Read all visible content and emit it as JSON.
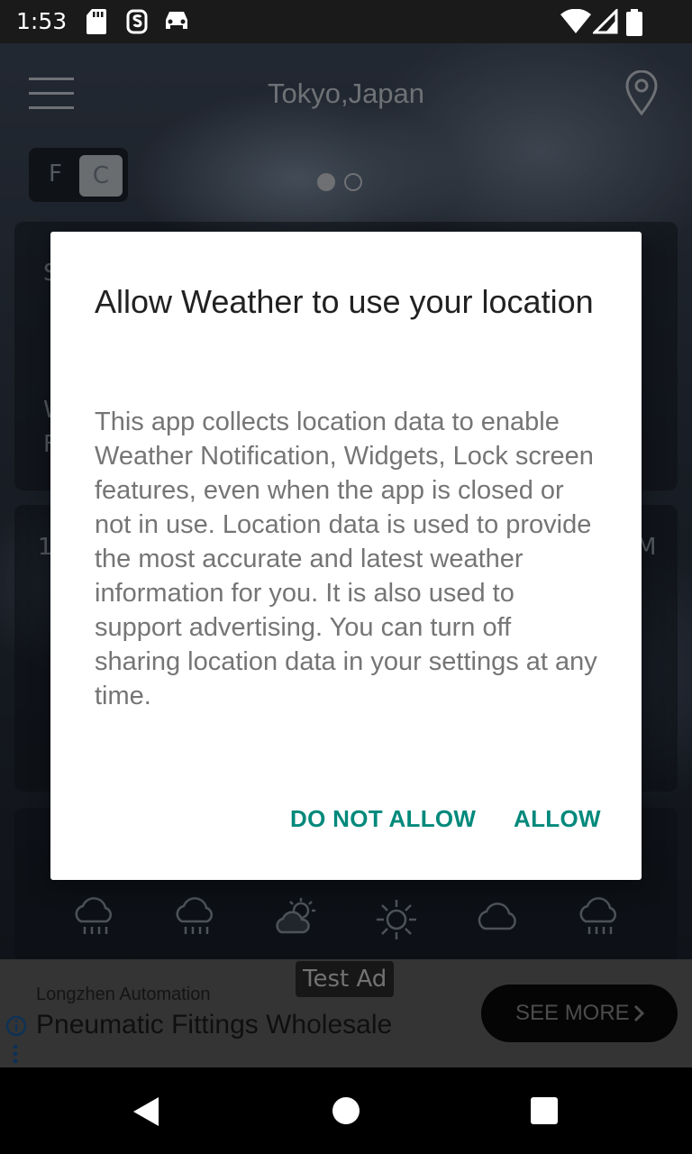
{
  "status_bar": {
    "time": "1:53"
  },
  "header": {
    "location": "Tokyo,Japan"
  },
  "units": {
    "f": "F",
    "c": "C"
  },
  "peeks": {
    "s": "S",
    "w": "W",
    "f": "F",
    "one": "1",
    "m": "M"
  },
  "dialog": {
    "title": "Allow Weather to use your location",
    "body": "This app collects location data to enable Weather Notification, Widgets, Lock screen features, even when the app is closed or not in use. Location data is used to provide the most accurate and latest weather information for you. It is also used to support advertising. You can turn off sharing location data in your settings at any time.",
    "deny_label": "DO NOT ALLOW",
    "allow_label": "ALLOW"
  },
  "forecast_icons": [
    "rain-cloud-icon",
    "rain-cloud-icon",
    "partly-sunny-icon",
    "sun-icon",
    "cloud-icon",
    "rain-cloud-icon"
  ],
  "ad": {
    "tag": "Test Ad",
    "company": "Longzhen Automation",
    "headline": "Pneumatic Fittings Wholesale",
    "cta": "SEE MORE"
  },
  "colors": {
    "accent": "#00897b",
    "dialog_bg": "#ffffff"
  }
}
